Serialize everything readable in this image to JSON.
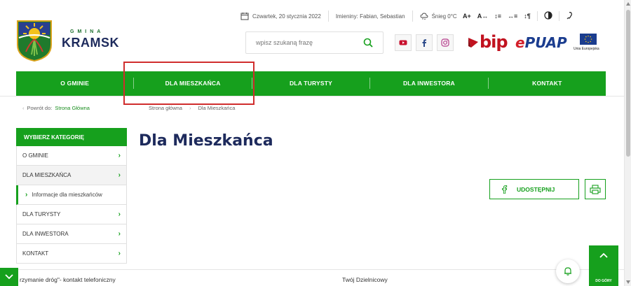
{
  "topbar": {
    "date": "Czwartek, 20 stycznia 2022",
    "nameday": "Imieniny: Fabian, Sebastian",
    "weather": "Śnieg 0°C"
  },
  "accessibility": {
    "font_larger": "A+",
    "font_smaller": "A↔",
    "line_height": "↕≡",
    "letter_spacing": "↔≡",
    "paragraph": "↕¶"
  },
  "logo": {
    "gmina": "GMINA",
    "name": "KRAMSK"
  },
  "search": {
    "placeholder": "wpisz szukaną frazę"
  },
  "brands": {
    "bip": "bip",
    "epuap_e": "e",
    "epuap_rest": "PUAP",
    "eu_label": "Unia Europejska"
  },
  "nav": [
    {
      "label": "O GMINIE"
    },
    {
      "label": "DLA MIESZKAŃCA"
    },
    {
      "label": "DLA TURYSTY"
    },
    {
      "label": "DLA INWESTORA"
    },
    {
      "label": "KONTAKT"
    }
  ],
  "breadcrumb": {
    "back_prefix": "Powrót do:",
    "back_link": "Strona Główna",
    "items": [
      "Strona główna",
      "Dla Mieszkańca"
    ]
  },
  "sidebar": {
    "heading": "WYBIERZ KATEGORIĘ",
    "items": [
      {
        "label": "O GMINIE"
      },
      {
        "label": "DLA MIESZKAŃCA"
      },
      {
        "label": "Informacje dla mieszkańców"
      },
      {
        "label": "DLA TURYSTY"
      },
      {
        "label": "DLA INWESTORA"
      },
      {
        "label": "KONTAKT"
      }
    ]
  },
  "main": {
    "title": "Dla Mieszkańca",
    "share_label": "UDOSTĘPNIJ"
  },
  "footer": {
    "left_text": "rzymanie dróg\"- kontakt telefoniczny",
    "mid_text": "Twój Dzielnicowy",
    "totop_label": "DO GÓRY"
  },
  "colors": {
    "green": "#16a01d",
    "navy": "#1d2a5c",
    "highlight": "#d02d2d"
  }
}
